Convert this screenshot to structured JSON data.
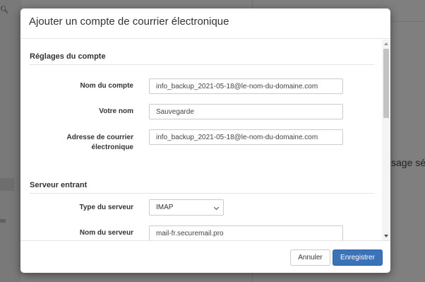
{
  "background": {
    "partial_text": "sage sélec"
  },
  "modal": {
    "title": "Ajouter un compte de courrier électronique",
    "sections": {
      "account": {
        "title": "Réglages du compte",
        "account_name_label": "Nom du compte",
        "account_name_value": "info_backup_2021-05-18@le-nom-du-domaine.com",
        "your_name_label": "Votre nom",
        "your_name_value": "Sauvegarde",
        "email_label_line1": "Adresse de courrier",
        "email_label_line2": "électronique",
        "email_value": "info_backup_2021-05-18@le-nom-du-domaine.com"
      },
      "incoming": {
        "title": "Serveur entrant",
        "server_type_label": "Type du serveur",
        "server_type_value": "IMAP",
        "server_name_label": "Nom du serveur",
        "server_name_value": "mail-fr.securemail.pro"
      }
    },
    "footer": {
      "cancel_label": "Annuler",
      "save_label": "Enregistrer"
    }
  },
  "colors": {
    "primary_button": "#3a73b7",
    "overlay": "rgba(0,0,0,0.5)"
  }
}
